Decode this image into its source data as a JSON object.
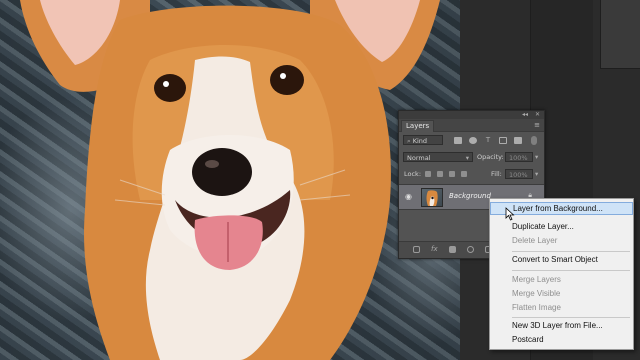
{
  "layers_panel": {
    "tab_label": "Layers",
    "filter_label": "Kind",
    "blend_mode": "Normal",
    "opacity_label": "Opacity:",
    "opacity_value": "100%",
    "lock_label": "Lock:",
    "fill_label": "Fill:",
    "fill_value": "100%",
    "layer_name": "Background",
    "collapse_icon": "double-chevron-icon",
    "close_icon": "close-icon",
    "eye_icon": "eye-icon",
    "lock_icon": "lock-icon"
  },
  "context_menu": {
    "items": [
      {
        "label": "Layer from Background...",
        "enabled": true,
        "highlighted": true
      },
      {
        "label": "Duplicate Layer...",
        "enabled": true
      },
      {
        "label": "Delete Layer",
        "enabled": false
      },
      {
        "label": "Convert to Smart Object",
        "enabled": true
      },
      {
        "label": "Merge Layers",
        "enabled": false
      },
      {
        "label": "Merge Visible",
        "enabled": false
      },
      {
        "label": "Flatten Image",
        "enabled": false
      },
      {
        "label": "New 3D Layer from File...",
        "enabled": true
      },
      {
        "label": "Postcard",
        "enabled": true
      }
    ]
  },
  "colors": {
    "panel_bg": "#535353",
    "selected_layer": "#6f6f74",
    "menu_bg": "#f0f0f0",
    "menu_highlight": "#cfe3f7",
    "dog_fur": "#d8893f"
  }
}
